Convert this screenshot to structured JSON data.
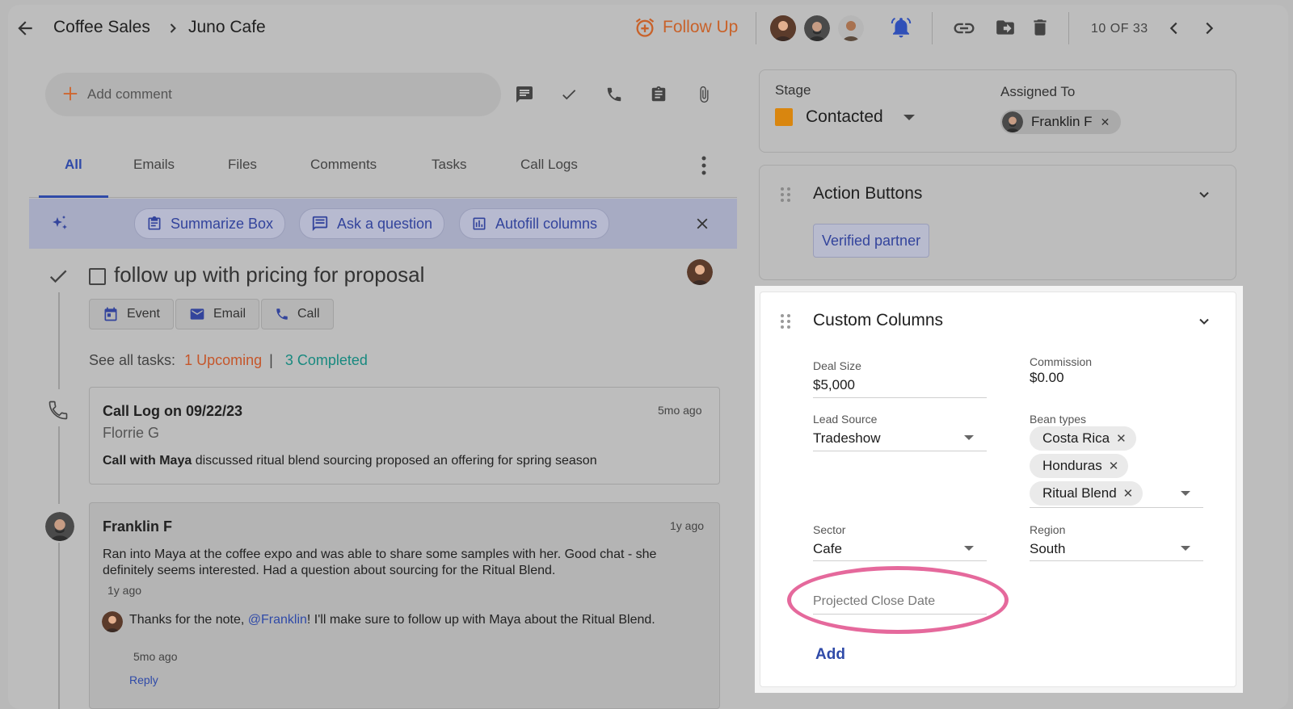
{
  "header": {
    "breadcrumb_parent": "Coffee Sales",
    "breadcrumb_current": "Juno Cafe",
    "follow_up_label": "Follow Up",
    "counter": "10 OF 33"
  },
  "composer": {
    "placeholder": "Add comment"
  },
  "tabs": [
    {
      "label": "All"
    },
    {
      "label": "Emails"
    },
    {
      "label": "Files"
    },
    {
      "label": "Comments"
    },
    {
      "label": "Tasks"
    },
    {
      "label": "Call Logs"
    }
  ],
  "ai_bar": {
    "summarize": "Summarize Box",
    "ask": "Ask a question",
    "autofill": "Autofill columns"
  },
  "task": {
    "title": "follow up with pricing for proposal",
    "event": "Event",
    "email": "Email",
    "call": "Call",
    "see_all": "See all tasks:",
    "upcoming": "1 Upcoming",
    "sep": "|",
    "completed": "3 Completed"
  },
  "call_log": {
    "title": "Call Log on 09/22/23",
    "time": "5mo ago",
    "author": "Florrie G",
    "body_bold": "Call with Maya",
    "body_rest": " discussed ritual blend sourcing proposed an offering for spring season"
  },
  "comment": {
    "author": "Franklin F",
    "time": "1y ago",
    "body": "Ran into Maya at the coffee expo and was able to share some samples with her. Good chat - she definitely seems interested. Had a question about sourcing for the Ritual Blend.",
    "sub_time": "1y ago",
    "reply_pre": "Thanks for the note, ",
    "reply_mention": "@Franklin",
    "reply_post": "! I'll make sure to follow up with Maya about the Ritual Blend.",
    "reply_time": "5mo ago",
    "reply_link": "Reply"
  },
  "stage_panel": {
    "stage_label": "Stage",
    "stage_value": "Contacted",
    "stage_color": "#e08a12",
    "assigned_label": "Assigned To",
    "assignee": "Franklin F"
  },
  "action_panel": {
    "title": "Action Buttons",
    "button": "Verified partner"
  },
  "custom_columns": {
    "title": "Custom Columns",
    "deal_size_label": "Deal Size",
    "deal_size": "$5,000",
    "commission_label": "Commission",
    "commission": "$0.00",
    "lead_source_label": "Lead Source",
    "lead_source": "Tradeshow",
    "bean_types_label": "Bean types",
    "bean_types": [
      "Costa Rica",
      "Honduras",
      "Ritual Blend"
    ],
    "sector_label": "Sector",
    "sector": "Cafe",
    "region_label": "Region",
    "region": "South",
    "close_date_placeholder": "Projected Close Date",
    "add_label": "Add"
  },
  "colors": {
    "accent": "#2f4aa8",
    "follow_up": "#c8622a",
    "highlight_ring": "#e5699c"
  }
}
